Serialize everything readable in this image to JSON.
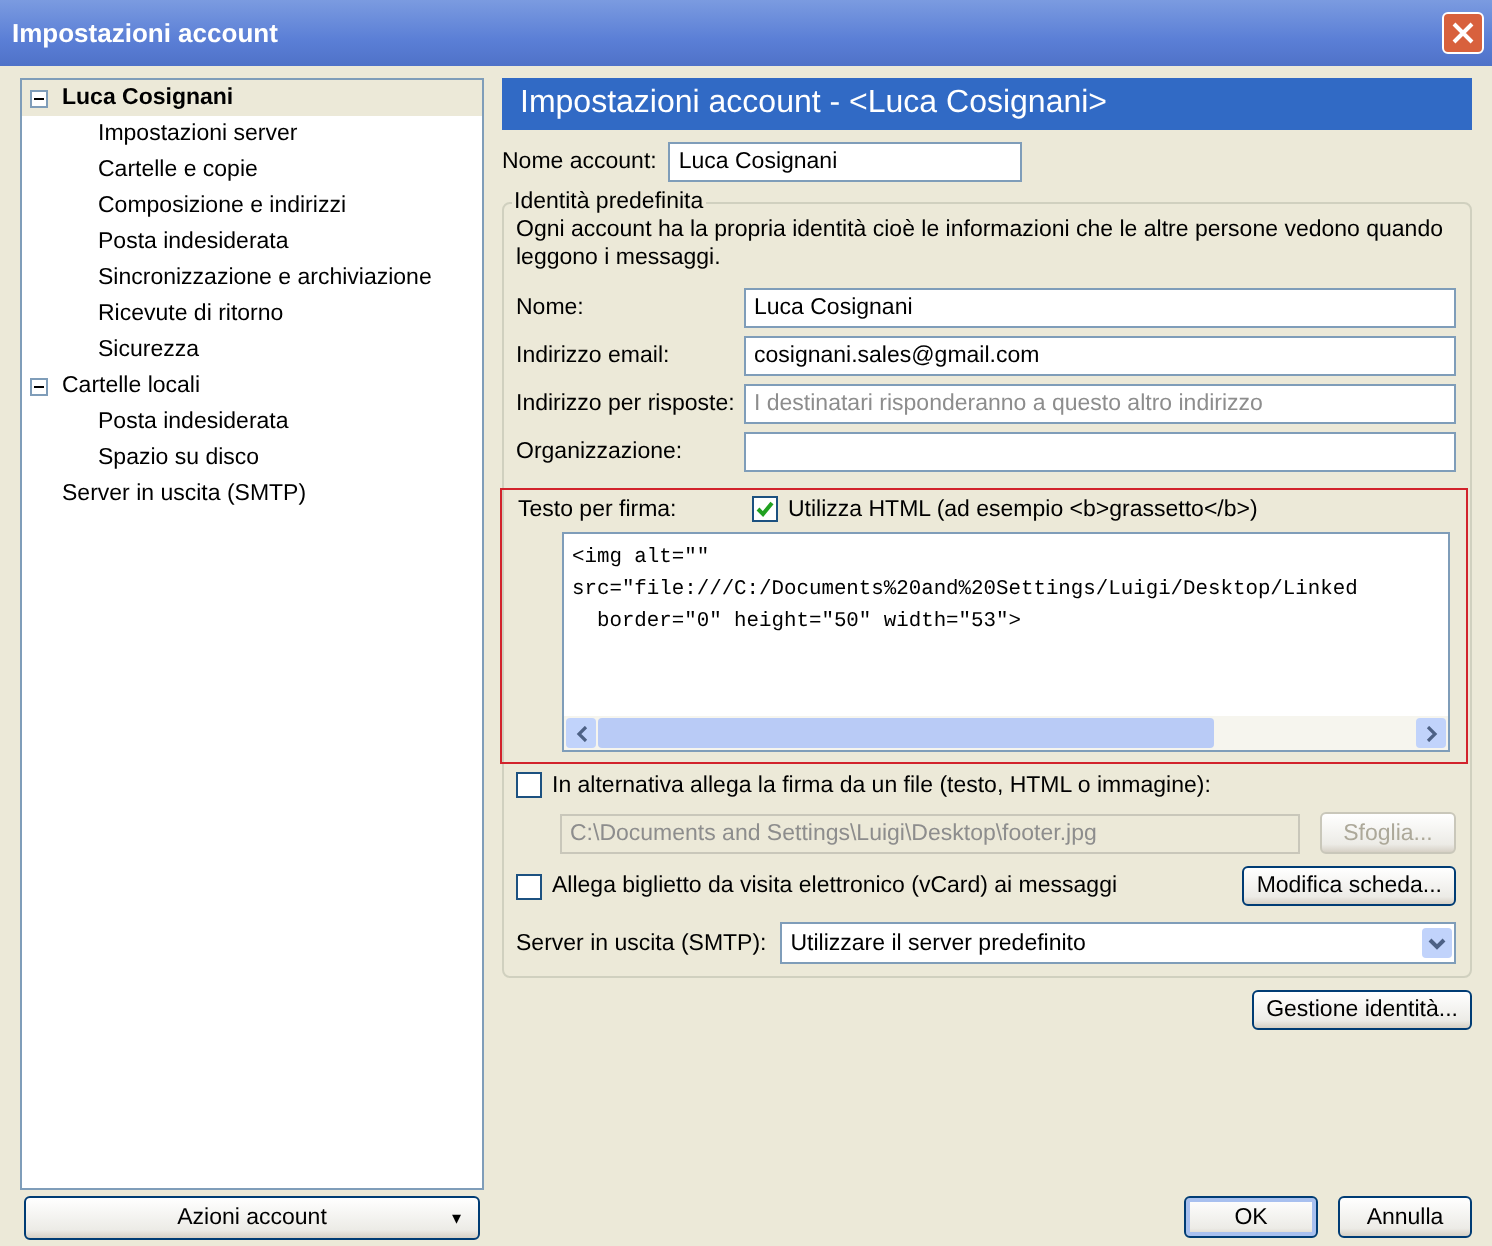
{
  "window": {
    "title": "Impostazioni account"
  },
  "tree": [
    {
      "label": "Luca Cosignani",
      "expanded": true,
      "selected": true,
      "children": [
        {
          "label": "Impostazioni server",
          "selected": false
        },
        {
          "label": "Cartelle e copie",
          "selected": false
        },
        {
          "label": "Composizione e indirizzi",
          "selected": false
        },
        {
          "label": "Posta indesiderata",
          "selected": false
        },
        {
          "label": "Sincronizzazione e archiviazione",
          "selected": false
        },
        {
          "label": "Ricevute di ritorno",
          "selected": false
        },
        {
          "label": "Sicurezza",
          "selected": false
        }
      ]
    },
    {
      "label": "Cartelle locali",
      "expanded": true,
      "selected": false,
      "children": [
        {
          "label": "Posta indesiderata",
          "selected": false
        },
        {
          "label": "Spazio su disco",
          "selected": false
        }
      ]
    },
    {
      "label": "Server in uscita (SMTP)",
      "selected": false
    }
  ],
  "account_actions_button": {
    "label": "Azioni account",
    "caret": "▾"
  },
  "header": "Impostazioni account - <Luca Cosignani>",
  "account_name": {
    "label": "Nome account:",
    "value": "Luca Cosignani"
  },
  "identity": {
    "legend": "Identità predefinita",
    "description": "Ogni account ha la propria identità cioè le informazioni che le altre persone vedono quando leggono i messaggi.",
    "fields": [
      {
        "label": "Nome:",
        "value": "Luca Cosignani"
      },
      {
        "label": "Indirizzo email:",
        "value": "cosignani.sales@gmail.com"
      },
      {
        "label": "Indirizzo per risposte:",
        "placeholder": "I destinatari risponderanno a questo altro indirizzo"
      },
      {
        "label": "Organizzazione:"
      }
    ],
    "signature": {
      "label": "Testo per firma:",
      "use_html": {
        "label": "Utilizza HTML (ad esempio <b>grassetto</b>)",
        "checked": true
      },
      "lines": [
        "<img alt=\"\"",
        "src=\"file:///C:/Documents%20and%20Settings/Luigi/Desktop/Linked",
        "  border=\"0\" height=\"50\" width=\"53\">"
      ]
    },
    "attach_file": {
      "label": "In alternativa allega la firma da un file (testo, HTML o immagine):",
      "checked": false,
      "path": "C:\\Documents and Settings\\Luigi\\Desktop\\footer.jpg",
      "path_disabled": true,
      "browse": "Sfoglia...",
      "browse_disabled": true
    },
    "vcard": {
      "label": "Allega biglietto da visita elettronico (vCard) ai messaggi",
      "checked": false,
      "button": "Modifica scheda..."
    },
    "smtp": {
      "label": "Server in uscita (SMTP):",
      "value": "Utilizzare il server predefinito"
    }
  },
  "identities_button": "Gestione identità...",
  "buttons": [
    {
      "label": "OK",
      "default": true
    },
    {
      "label": "Annulla",
      "default": false
    }
  ]
}
